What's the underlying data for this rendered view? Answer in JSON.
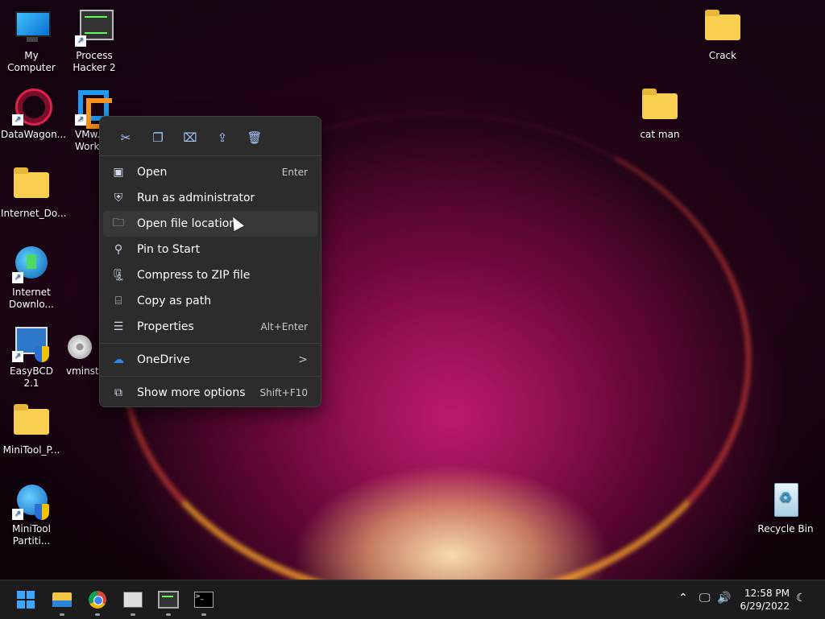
{
  "desktop": {
    "icons": [
      {
        "label": "My Computer"
      },
      {
        "label": "Process Hacker 2"
      },
      {
        "label": "DataWagon..."
      },
      {
        "label": "VMw... Workst..."
      },
      {
        "label": "Internet_Do..."
      },
      {
        "label": "Internet Downlo..."
      },
      {
        "label": "EasyBCD 2.1"
      },
      {
        "label": "vminsta..."
      },
      {
        "label": "MiniTool_P..."
      },
      {
        "label": "MiniTool Partiti..."
      },
      {
        "label": "Crack"
      },
      {
        "label": "cat man"
      },
      {
        "label": "Recycle Bin"
      }
    ]
  },
  "context_menu": {
    "quick_actions": [
      {
        "name": "cut",
        "icon": "scissors-icon",
        "glyph": "✂"
      },
      {
        "name": "copy",
        "icon": "copy-icon",
        "glyph": "❐"
      },
      {
        "name": "rename",
        "icon": "rename-icon",
        "glyph": "⌧"
      },
      {
        "name": "share",
        "icon": "share-icon",
        "glyph": "⇪"
      },
      {
        "name": "delete",
        "icon": "trash-icon",
        "glyph": "🗑"
      }
    ],
    "items": [
      {
        "label": "Open",
        "shortcut": "Enter"
      },
      {
        "label": "Run as administrator",
        "shortcut": ""
      },
      {
        "label": "Open file location",
        "shortcut": ""
      },
      {
        "label": "Pin to Start",
        "shortcut": ""
      },
      {
        "label": "Compress to ZIP file",
        "shortcut": ""
      },
      {
        "label": "Copy as path",
        "shortcut": ""
      },
      {
        "label": "Properties",
        "shortcut": "Alt+Enter"
      },
      {
        "label": "OneDrive",
        "shortcut": ""
      },
      {
        "label": "Show more options",
        "shortcut": "Shift+F10"
      }
    ],
    "onedrive_arrow": ">"
  },
  "taskbar": {
    "clock": {
      "time": "12:58 PM",
      "date": "6/29/2022"
    }
  },
  "colors": {
    "menu_bg": "#2c2c2c",
    "taskbar_bg": "#1c1c1c",
    "accent": "#3aa6ff"
  }
}
